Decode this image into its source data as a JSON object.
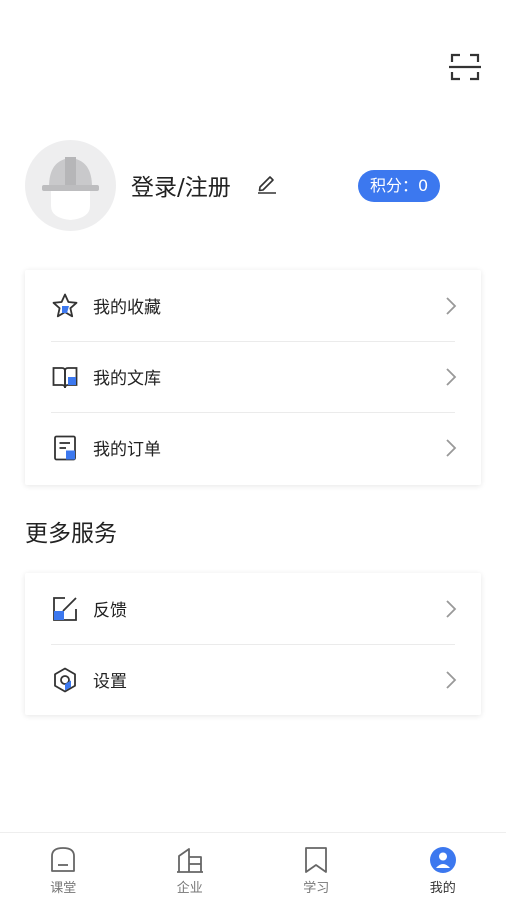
{
  "header": {
    "scan_icon": "scan-icon"
  },
  "profile": {
    "avatar_icon": "helmet-icon",
    "login_label": "登录/注册",
    "edit_icon": "pencil-icon",
    "points_label": "积分：0"
  },
  "menu": {
    "items": [
      {
        "label": "我的收藏",
        "icon": "star-icon"
      },
      {
        "label": "我的文库",
        "icon": "book-icon"
      },
      {
        "label": "我的订单",
        "icon": "order-icon"
      }
    ]
  },
  "more_services": {
    "title": "更多服务",
    "items": [
      {
        "label": "反馈",
        "icon": "feedback-icon"
      },
      {
        "label": "设置",
        "icon": "settings-icon"
      }
    ]
  },
  "tabbar": {
    "tabs": [
      {
        "label": "课堂",
        "icon": "classroom-icon"
      },
      {
        "label": "企业",
        "icon": "enterprise-icon"
      },
      {
        "label": "学习",
        "icon": "bookmark-icon"
      },
      {
        "label": "我的",
        "icon": "profile-icon"
      }
    ]
  },
  "colors": {
    "accent": "#3c78ef",
    "icon_stroke": "#333333",
    "divider": "#ebebeb"
  }
}
